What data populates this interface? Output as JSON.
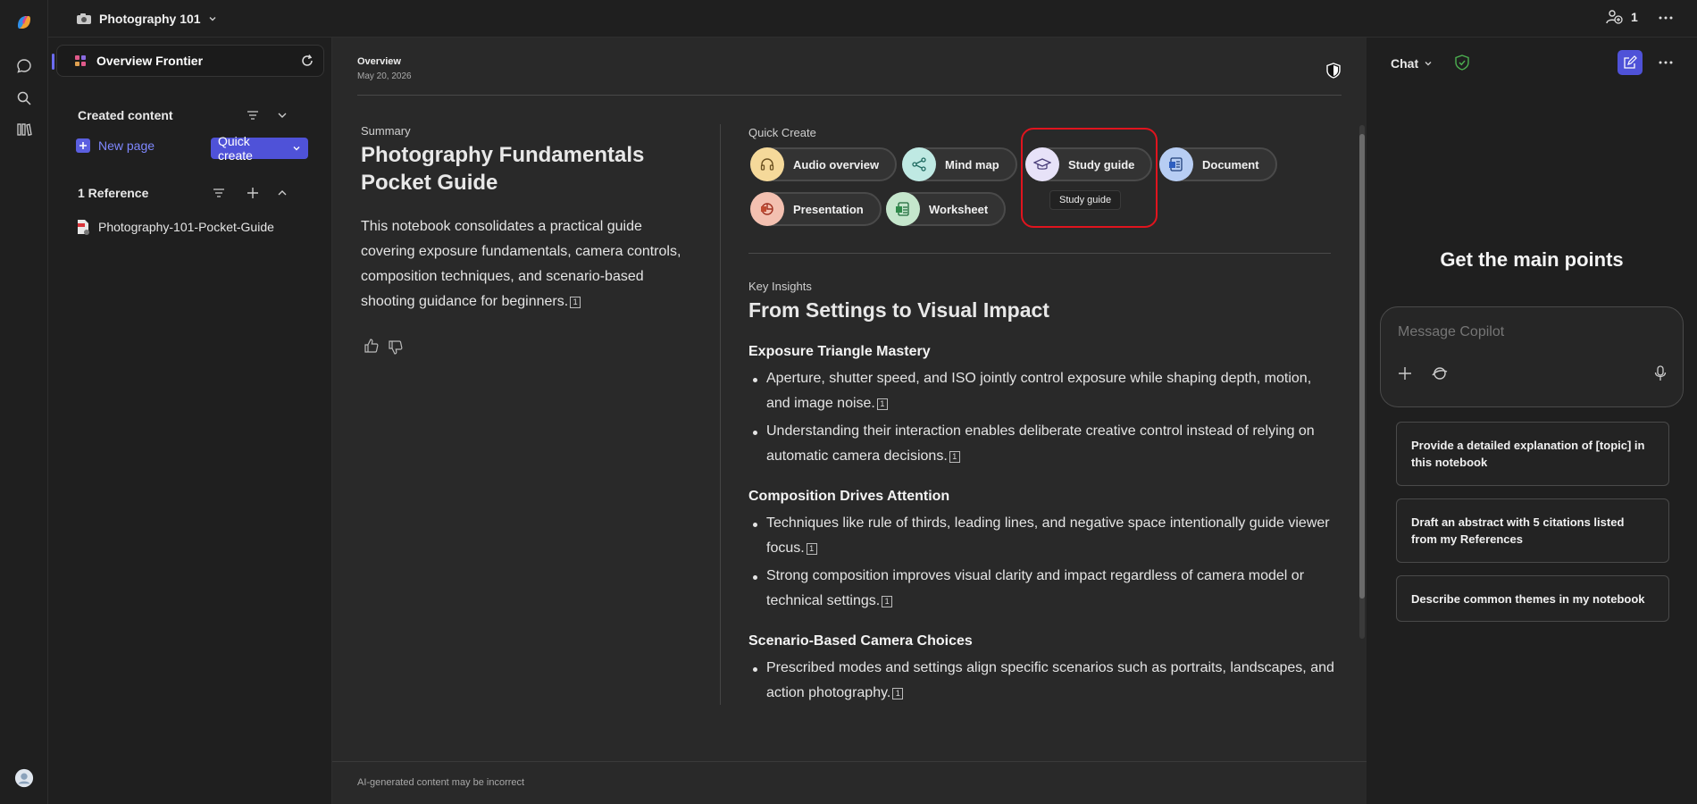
{
  "topbar": {
    "notebook_title": "Photography 101",
    "share_count": "1"
  },
  "sidebar": {
    "overview_label": "Overview Frontier",
    "created_content_label": "Created content",
    "new_page_label": "New page",
    "quick_create_label": "Quick create",
    "references_label": "1 Reference",
    "reference_items": [
      "Photography-101-Pocket-Guide"
    ]
  },
  "main": {
    "breadcrumb": "Overview",
    "date": "May 20, 2026",
    "summary": {
      "eyebrow": "Summary",
      "title": "Photography Fundamentals Pocket Guide",
      "body": "This notebook consolidates a practical guide covering exposure fundamentals, camera controls, composition techniques, and scenario-based shooting guidance for beginners.",
      "cite": "1"
    },
    "quick_create": {
      "label": "Quick Create",
      "chips": [
        "Audio overview",
        "Mind map",
        "Study guide",
        "Document",
        "Presentation",
        "Worksheet"
      ],
      "tooltip": "Study guide"
    },
    "insights": {
      "eyebrow": "Key Insights",
      "title": "From Settings to Visual Impact",
      "sections": [
        {
          "heading": "Exposure Triangle Mastery",
          "bullets": [
            [
              "Aperture, shutter speed, and ISO jointly control exposure while shaping depth, motion,",
              "and image noise."
            ],
            [
              "Understanding their interaction enables deliberate creative control instead of relying on",
              "automatic camera decisions."
            ]
          ]
        },
        {
          "heading": "Composition Drives Attention",
          "bullets": [
            [
              "Techniques like rule of thirds, leading lines, and negative space intentionally guide viewer",
              "focus."
            ],
            [
              "Strong composition improves visual clarity and impact regardless of camera model or",
              "technical settings."
            ]
          ]
        },
        {
          "heading": "Scenario-Based Camera Choices",
          "bullets": [
            [
              "Prescribed modes and settings align specific scenarios such as portraits, landscapes, and",
              "action photography."
            ]
          ]
        }
      ],
      "cite": "1"
    },
    "footer_disclaimer": "AI-generated content may be incorrect"
  },
  "chat": {
    "title": "Chat",
    "heading": "Get the main points",
    "input_placeholder": "Message Copilot",
    "suggestions": [
      [
        "Provide a detailed explanation of [topic] in",
        "this notebook"
      ],
      [
        "Draft an abstract with 5 citations listed",
        "from my References"
      ],
      [
        "Describe common themes in my notebook"
      ]
    ]
  },
  "colors": {
    "accent": "#4f52d8",
    "highlight_box": "#e0141e",
    "shield_green": "#4caf50"
  }
}
